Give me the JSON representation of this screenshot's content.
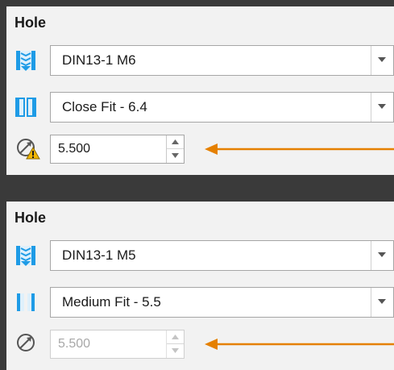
{
  "panels": [
    {
      "title": "Hole",
      "thread_value": "DIN13-1 M6",
      "fit_value": "Close Fit - 6.4",
      "diameter_value": "5.500",
      "diameter_warning": true,
      "diameter_disabled": false
    },
    {
      "title": "Hole",
      "thread_value": "DIN13-1 M5",
      "fit_value": "Medium Fit - 5.5",
      "diameter_value": "5.500",
      "diameter_warning": false,
      "diameter_disabled": true
    }
  ],
  "icons": {
    "thread": "threaded-hole-icon",
    "fit": "clearance-fit-icon",
    "diameter": "diameter-icon",
    "warning": "warning-triangle-icon",
    "dropdown": "chevron-down-icon",
    "spin_up": "spin-up-icon",
    "spin_down": "spin-down-icon",
    "annotation": "arrow-left-icon"
  },
  "colors": {
    "background": "#3a3a3a",
    "panel": "#f2f2f2",
    "icon_blue": "#1e9be6",
    "warning": "#f2b600",
    "annotation_arrow": "#e58000"
  }
}
